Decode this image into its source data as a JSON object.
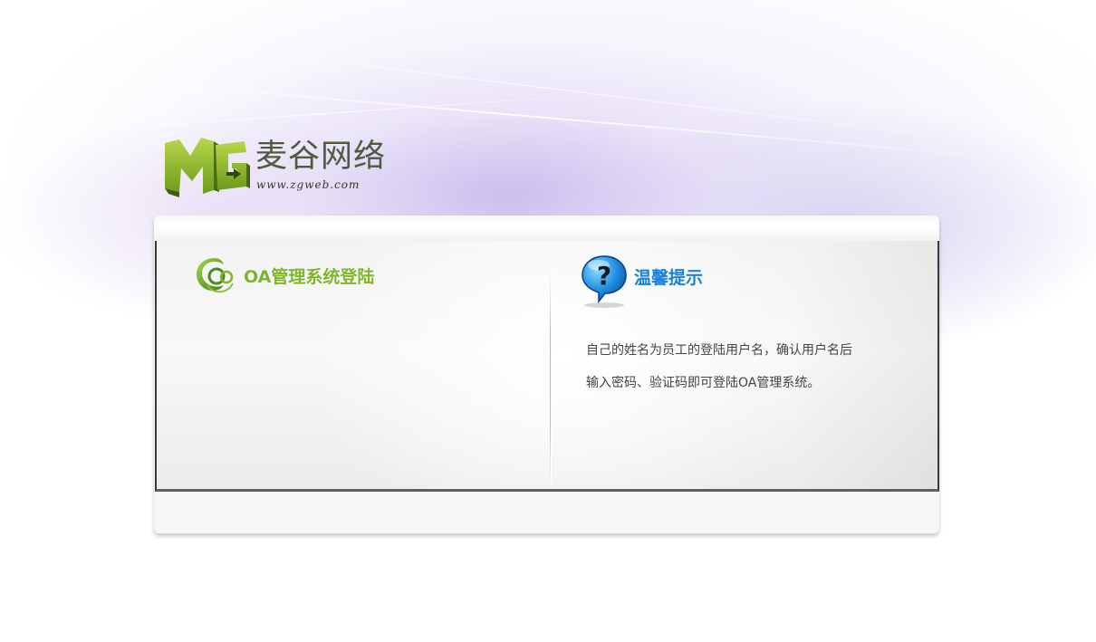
{
  "brand": {
    "logo_mark": "MG",
    "name": "麦谷网络",
    "url": "www.zgweb.com"
  },
  "login": {
    "title": "OA管理系统登陆",
    "icon": "swirl-logo-icon"
  },
  "tips": {
    "title": "温馨提示",
    "icon": "question-bubble-icon",
    "lines": [
      "自己的姓名为员工的登陆用户名，确认用户名后",
      "输入密码、验证码即可登陆OA管理系统。"
    ]
  },
  "colors": {
    "brand_green": "#7fb52a",
    "tips_blue": "#1a82d6",
    "background_lavender": "#d9cff2"
  }
}
